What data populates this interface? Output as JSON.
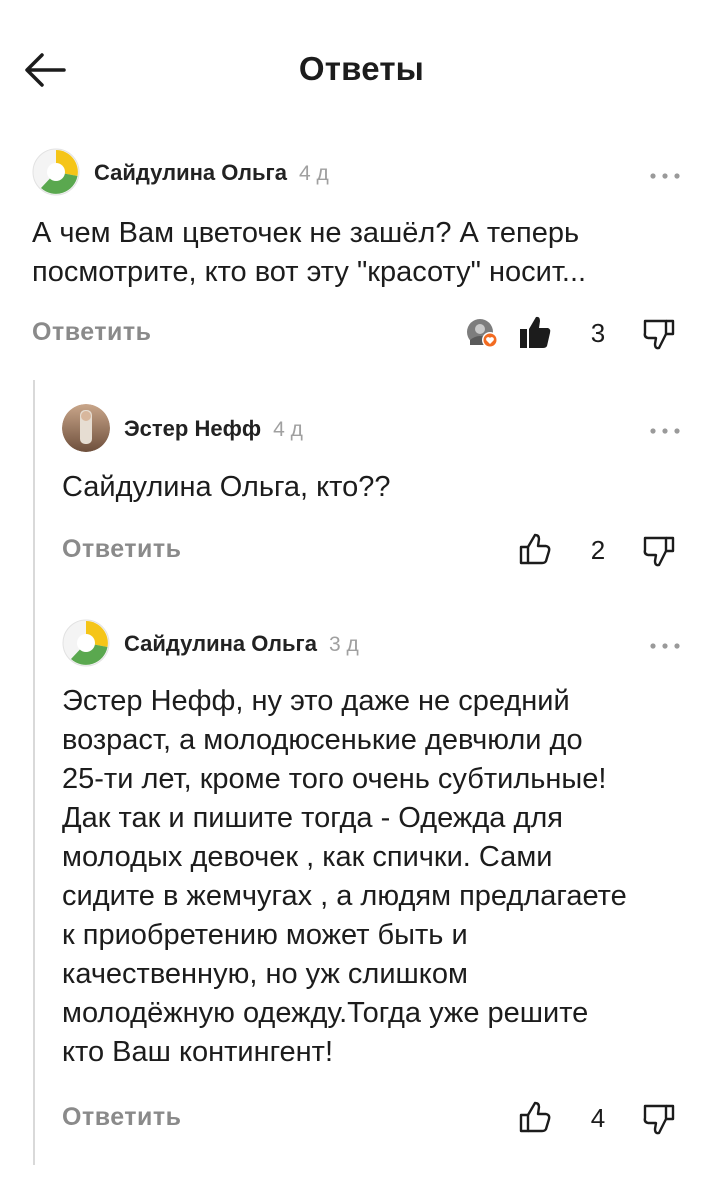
{
  "header": {
    "title": "Ответы"
  },
  "comments": [
    {
      "author": "Сайдулина Ольга",
      "time": "4 д",
      "text": "А чем Вам цветочек не зашёл? А теперь\nпосмотрите, кто вот эту \"красоту\" носит...",
      "reply_label": "Ответить",
      "likes": "3",
      "liked": true
    },
    {
      "author": "Эстер Нефф",
      "time": "4 д",
      "text": "Сайдулина Ольга, кто??",
      "reply_label": "Ответить",
      "likes": "2",
      "liked": false
    },
    {
      "author": "Сайдулина Ольга",
      "time": "3 д",
      "text": "Эстер Нефф, ну это даже не средний\nвозраст, а молодюсенькие девчюли до\n25-ти лет, кроме того очень субтильные!\nДак так и пишите тогда - Одежда для\nмолодых девочек , как спички. Сами\nсидите в жемчугах , а людям предлагаете\nк приобретению  может быть и\nкачественную, но уж слишком\nмолодёжную одежду.Тогда уже решите\nкто Ваш контингент!",
      "reply_label": "Ответить",
      "likes": "4",
      "liked": false
    }
  ],
  "icons": {
    "back": "arrow-left-icon",
    "more": "more-dots-icon",
    "like": "thumbs-up-icon",
    "dislike": "thumbs-down-icon"
  },
  "colors": {
    "logo_yellow": "#f5c518",
    "logo_green": "#5aa84f",
    "muted_text": "#8a8a8a",
    "reaction_orange": "#f26b21"
  }
}
